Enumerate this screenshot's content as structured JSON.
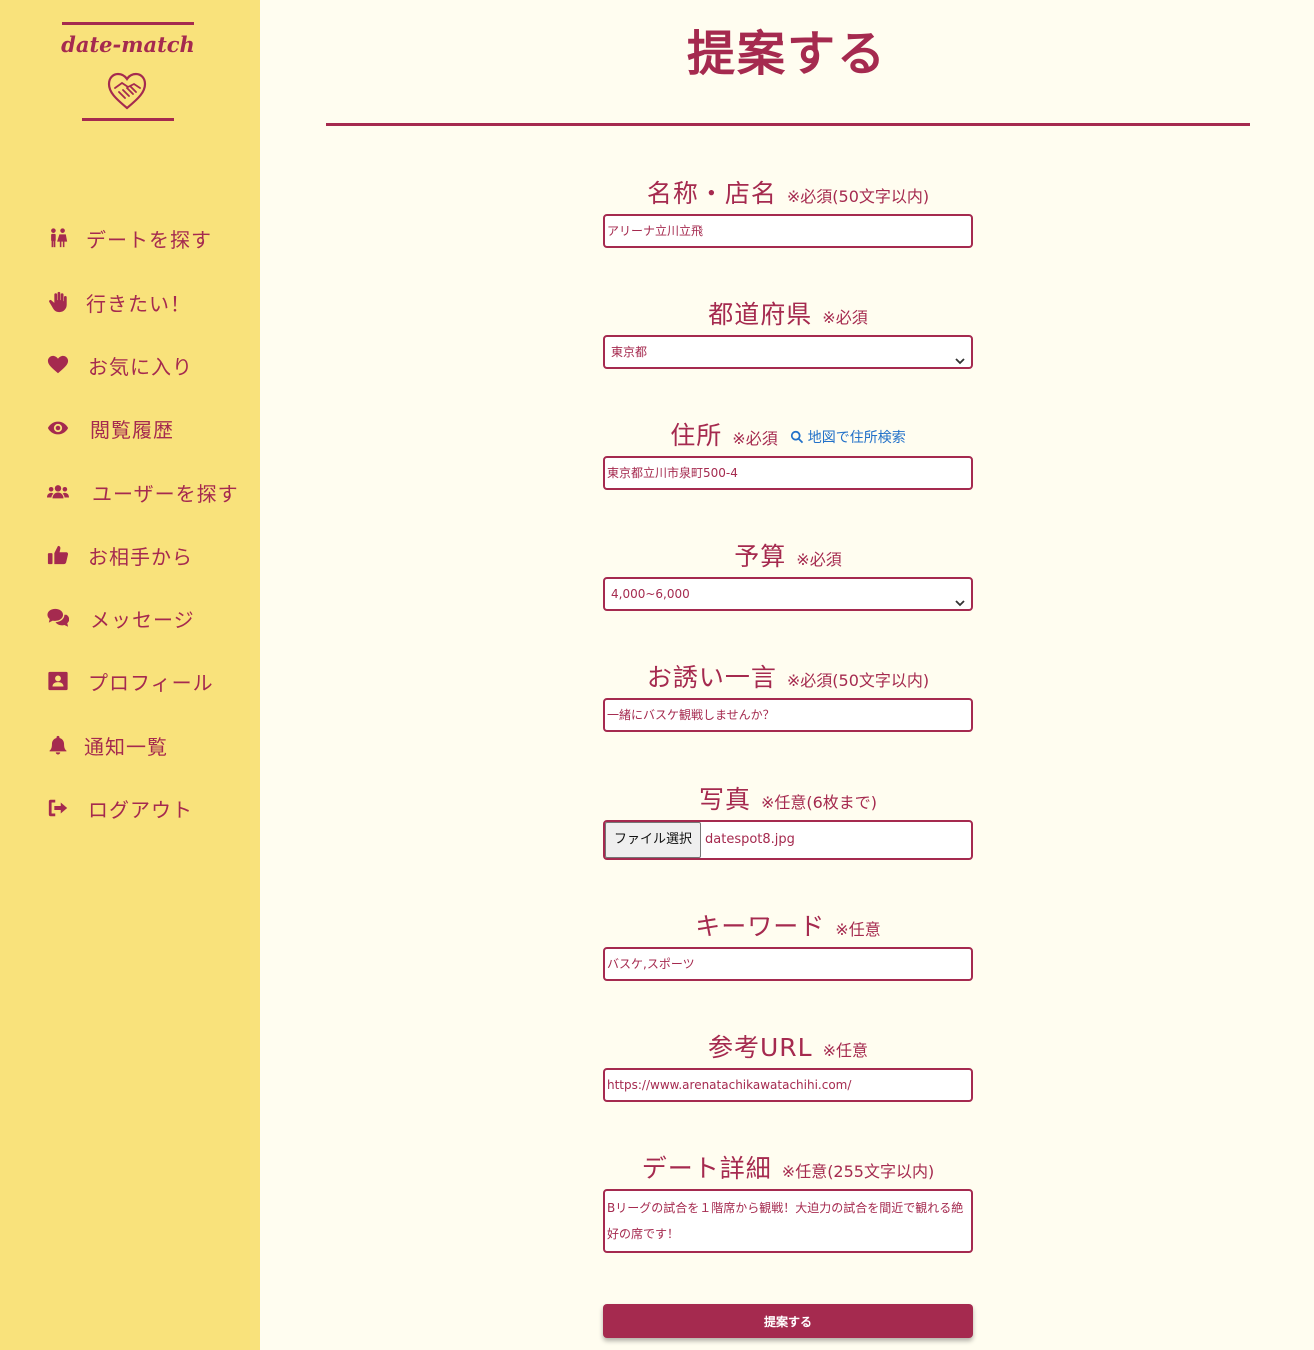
{
  "app": {
    "logo_text": "date-match"
  },
  "sidebar": {
    "items": [
      {
        "label": "デートを探す",
        "icon": "couple-icon"
      },
      {
        "label": "行きたい！",
        "icon": "hand-icon"
      },
      {
        "label": "お気に入り",
        "icon": "heart-icon"
      },
      {
        "label": "閲覧履歴",
        "icon": "eye-icon"
      },
      {
        "label": "ユーザーを探す",
        "icon": "users-icon"
      },
      {
        "label": "お相手から",
        "icon": "thumbs-up-icon"
      },
      {
        "label": "メッセージ",
        "icon": "comments-icon"
      },
      {
        "label": "プロフィール",
        "icon": "id-card-icon"
      },
      {
        "label": "通知一覧",
        "icon": "bell-icon"
      },
      {
        "label": "ログアウト",
        "icon": "sign-out-icon"
      }
    ]
  },
  "page": {
    "title": "提案する"
  },
  "form": {
    "name": {
      "label": "名称・店名",
      "note": "※必須(50文字以内)",
      "value": "アリーナ立川立飛"
    },
    "prefecture": {
      "label": "都道府県",
      "note": "※必須",
      "selected": "東京都"
    },
    "address": {
      "label": "住所",
      "note": "※必須",
      "link": "地図で住所検索",
      "value": "東京都立川市泉町500-4"
    },
    "budget": {
      "label": "予算",
      "note": "※必須",
      "selected": "4,000~6,000"
    },
    "invite": {
      "label": "お誘い一言",
      "note": "※必須(50文字以内)",
      "value": "一緒にバスケ観戦しませんか？"
    },
    "photo": {
      "label": "写真",
      "note": "※任意(6枚まで)",
      "button": "ファイル選択",
      "file": "datespot8.jpg"
    },
    "keyword": {
      "label": "キーワード",
      "note": "※任意",
      "value": "バスケ,スポーツ"
    },
    "url": {
      "label": "参考URL",
      "note": "※任意",
      "value": "https://www.arenatachikawatachihi.com/"
    },
    "detail": {
      "label": "デート詳細",
      "note": "※任意(255文字以内)",
      "value": "Bリーグの試合を１階席から観戦！大迫力の試合を間近で観れる絶好の席です！"
    },
    "submit": "提案する"
  }
}
